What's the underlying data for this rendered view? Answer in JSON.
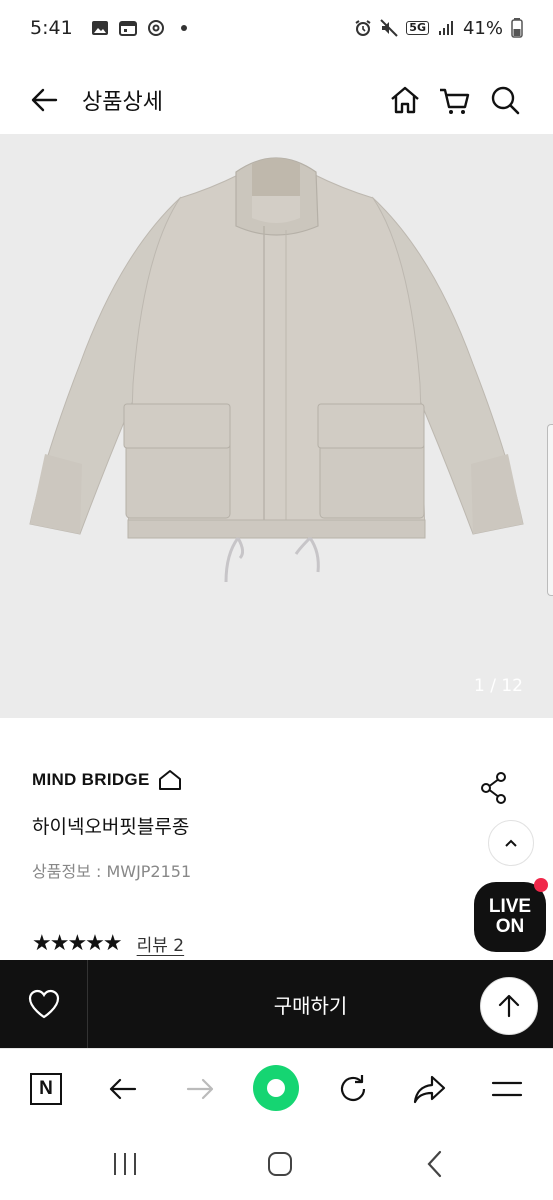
{
  "status": {
    "time": "5:41",
    "network": "5G",
    "battery": "41%"
  },
  "header": {
    "title": "상품상세"
  },
  "gallery": {
    "counter": "1 / 12"
  },
  "product": {
    "brand": "MIND BRIDGE",
    "name": "하이넥오버핏블루종",
    "info": "상품정보 : MWJP2151",
    "stars": "★★★★★",
    "rating": 5,
    "review_label": "리뷰 2"
  },
  "live": {
    "line1": "LIVE",
    "line2": "ON"
  },
  "buy_bar": {
    "buy_label": "구매하기"
  },
  "browser": {
    "home_letter": "N"
  },
  "colors": {
    "live_dot": "#f0284a",
    "browser_green": "#15d572",
    "buy_bar_bg": "#111111"
  }
}
